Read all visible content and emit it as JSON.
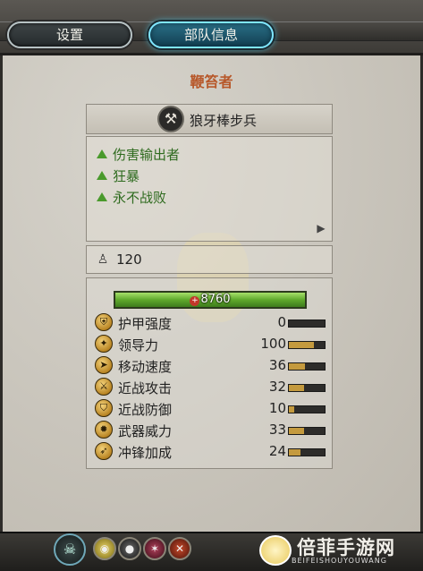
{
  "tabs": [
    {
      "label": "设置",
      "active": false
    },
    {
      "label": "部队信息",
      "active": true
    }
  ],
  "unit": {
    "category": "鞭笞者",
    "name": "狼牙棒步兵",
    "icon": "crossed-hammers-icon"
  },
  "traits": [
    "伤害输出者",
    "狂暴",
    "永不战败"
  ],
  "men": {
    "icon": "soldier-icon",
    "count": "120"
  },
  "health": {
    "value": "8760",
    "fill": 1.0
  },
  "stats": [
    {
      "label": "护甲强度",
      "value": "0",
      "fill": 0.0,
      "icon": "armor-icon"
    },
    {
      "label": "领导力",
      "value": "100",
      "fill": 0.7,
      "icon": "leadership-icon"
    },
    {
      "label": "移动速度",
      "value": "36",
      "fill": 0.45,
      "icon": "speed-icon"
    },
    {
      "label": "近战攻击",
      "value": "32",
      "fill": 0.42,
      "icon": "melee-attack-icon"
    },
    {
      "label": "近战防御",
      "value": "10",
      "fill": 0.15,
      "icon": "melee-defence-icon"
    },
    {
      "label": "武器威力",
      "value": "33",
      "fill": 0.42,
      "icon": "weapon-strength-icon"
    },
    {
      "label": "冲锋加成",
      "value": "24",
      "fill": 0.32,
      "icon": "charge-bonus-icon"
    }
  ],
  "watermark": {
    "text": "倍菲手游网",
    "sub": "BEIFEISHOUYOUWANG"
  },
  "colors": {
    "trait": "#2f6b1f",
    "title": "#b7582a",
    "health": "#5fa82c",
    "stat_fill": "#c49a3e"
  }
}
